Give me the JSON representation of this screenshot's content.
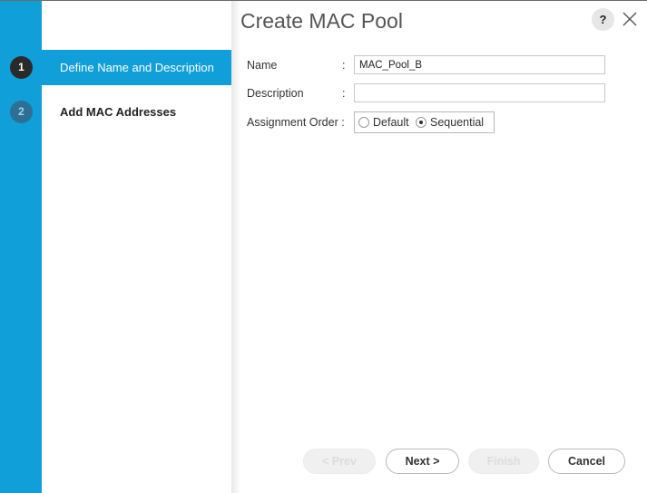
{
  "dialog": {
    "title": "Create MAC Pool",
    "help_label": "?",
    "close_icon": "close-x-icon"
  },
  "wizard": {
    "steps": [
      {
        "number": "1",
        "label": "Define Name and Description",
        "active": true
      },
      {
        "number": "2",
        "label": "Add MAC Addresses",
        "active": false
      }
    ]
  },
  "form": {
    "name": {
      "label": "Name",
      "colon": ":",
      "value": "MAC_Pool_B"
    },
    "description": {
      "label": "Description",
      "colon": ":",
      "value": ""
    },
    "assignment_order": {
      "label": "Assignment Order :",
      "options": [
        "Default",
        "Sequential"
      ],
      "selected": "Sequential"
    }
  },
  "buttons": {
    "prev": {
      "label": "< Prev",
      "enabled": false
    },
    "next": {
      "label": "Next >",
      "enabled": true
    },
    "finish": {
      "label": "Finish",
      "enabled": false
    },
    "cancel": {
      "label": "Cancel",
      "enabled": true
    }
  },
  "colors": {
    "accent": "#109fd8",
    "active_step_circle": "#2a2a2a",
    "inactive_step_circle": "#2e6f96"
  }
}
